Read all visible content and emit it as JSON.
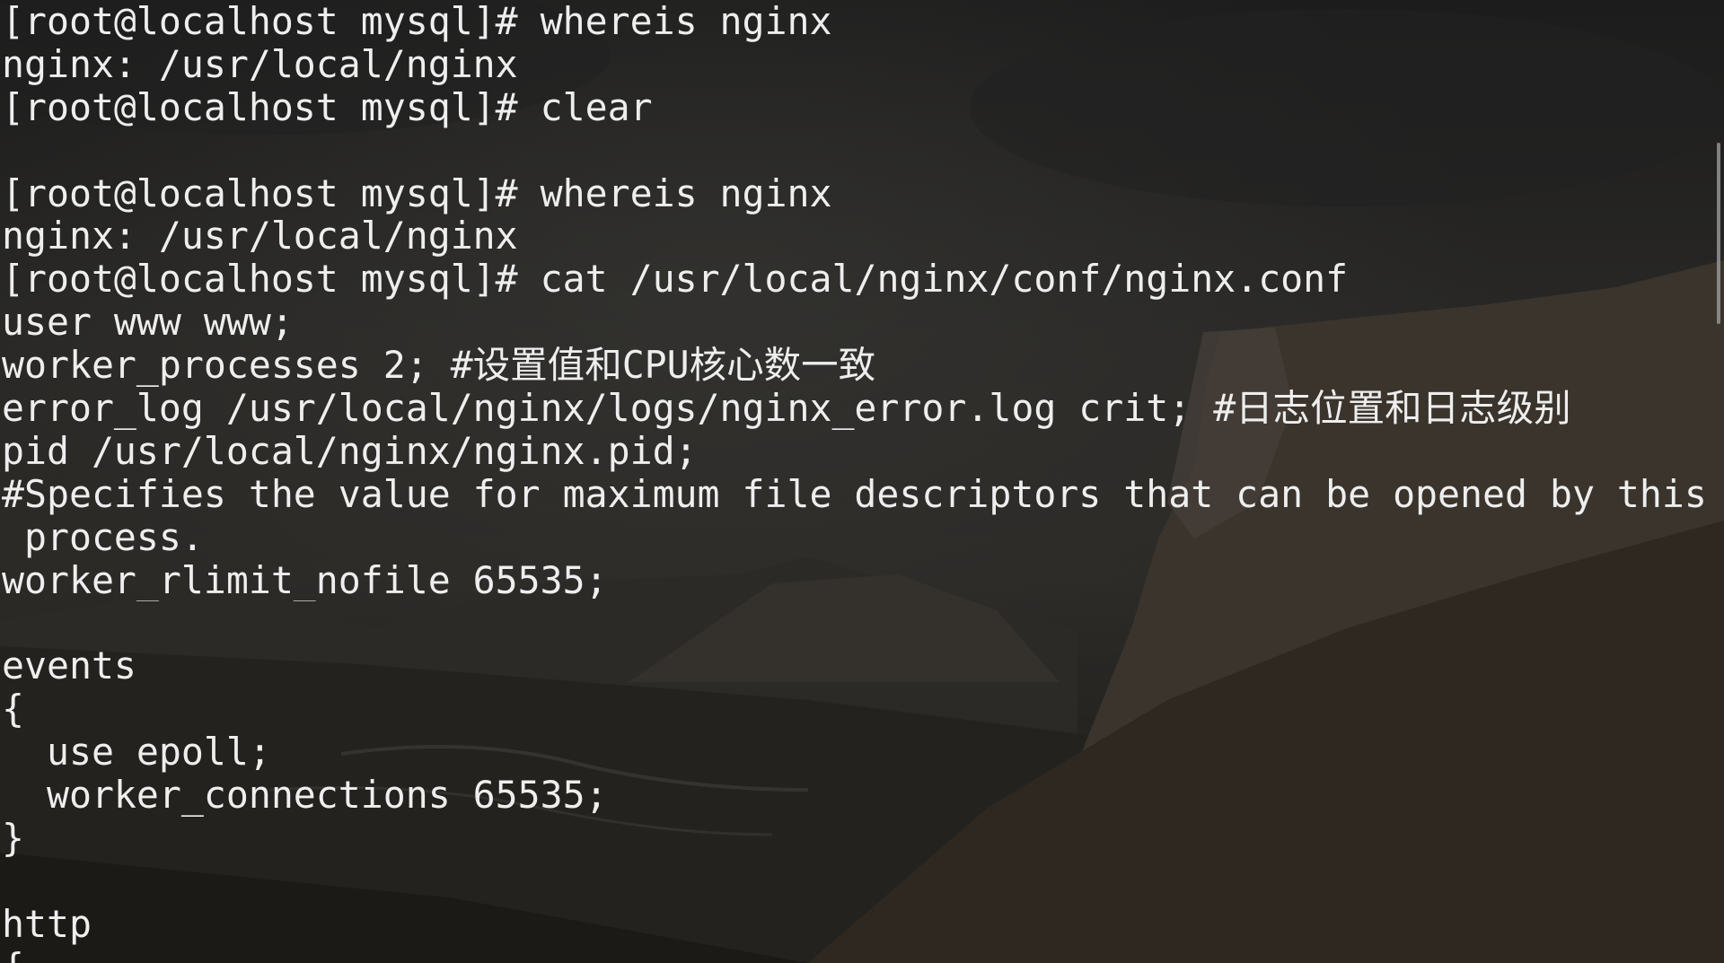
{
  "terminal": {
    "lines": [
      {
        "prompt": "[root@localhost mysql]#",
        "command": "whereis nginx"
      },
      {
        "text": "nginx: /usr/local/nginx"
      },
      {
        "prompt": "[root@localhost mysql]#",
        "command": "clear"
      },
      {
        "prompt": "[root@localhost mysql]#",
        "command": "whereis nginx"
      },
      {
        "text": "nginx: /usr/local/nginx"
      },
      {
        "prompt": "[root@localhost mysql]#",
        "command": "cat /usr/local/nginx/conf/nginx.conf"
      },
      {
        "text": "user www www;"
      },
      {
        "text": "worker_processes 2; #设置值和CPU核心数一致"
      },
      {
        "text": "error_log /usr/local/nginx/logs/nginx_error.log crit; #日志位置和日志级别"
      },
      {
        "text": "pid /usr/local/nginx/nginx.pid;"
      },
      {
        "text": "#Specifies the value for maximum file descriptors that can be opened by this"
      },
      {
        "text": " process."
      },
      {
        "text": "worker_rlimit_nofile 65535;"
      },
      {
        "text": "events"
      },
      {
        "text": "{"
      },
      {
        "text": "  use epoll;"
      },
      {
        "text": "  worker_connections 65535;"
      },
      {
        "text": "}"
      },
      {
        "text": "http"
      },
      {
        "text": "{"
      }
    ]
  },
  "colors": {
    "text": "#eeeeee",
    "background": "#1f1f1f",
    "scrollbar_thumb": "rgba(170,170,170,0.7)"
  }
}
